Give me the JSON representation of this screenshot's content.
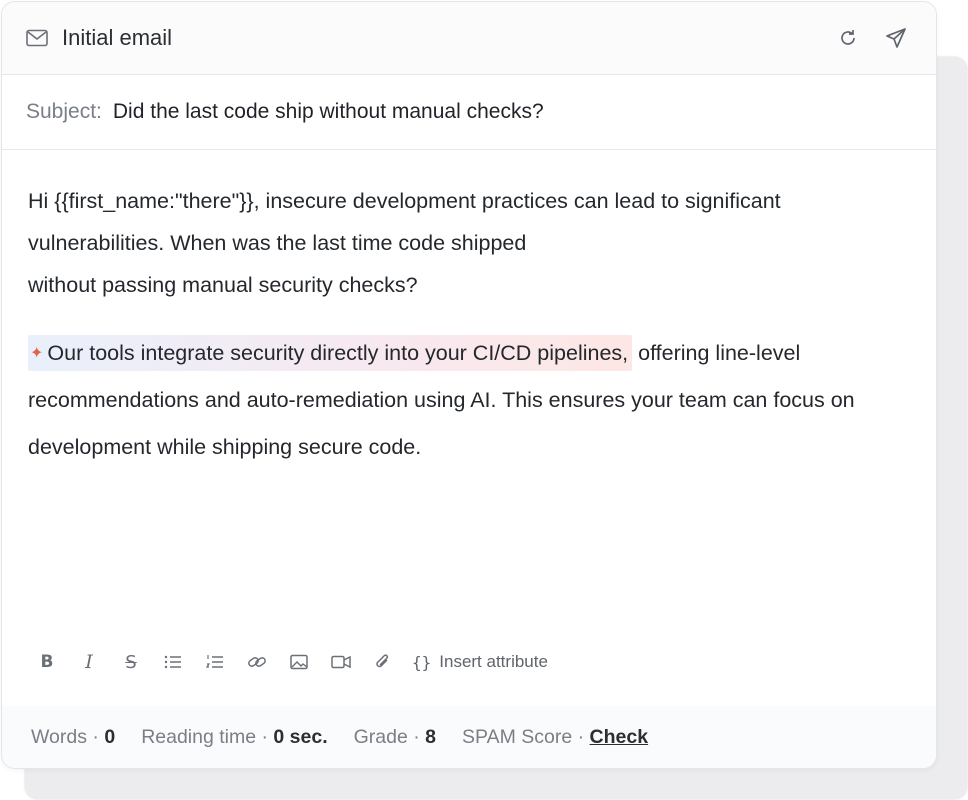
{
  "header": {
    "title": "Initial email"
  },
  "subject": {
    "label": "Subject:",
    "value": "Did the last code ship without manual checks?"
  },
  "body": {
    "p1_line1": "Hi {{first_name:\"there\"}}, insecure development practices can lead to significant",
    "p1_line2": "vulnerabilities. When was the last time code shipped",
    "p1_line3": "without passing manual security checks?",
    "p2_highlight": "Our tools integrate security directly into your CI/CD pipelines,",
    "p2_rest": " offering line-level recommendations and auto-remediation using AI. This ensures your team can focus on development while shipping secure code."
  },
  "toolbar": {
    "insert_attribute": "Insert attribute"
  },
  "footer": {
    "words_label": "Words · ",
    "words_value": "0",
    "reading_label": "Reading time · ",
    "reading_value": "0 sec.",
    "grade_label": "Grade · ",
    "grade_value": "8",
    "spam_label": "SPAM Score · ",
    "spam_link": "Check"
  },
  "icons": {
    "mail": "mail-icon",
    "refresh": "refresh-icon",
    "send": "send-icon",
    "sparkle": "sparkle-icon",
    "bold": "bold-icon",
    "italic": "italic-icon",
    "strike": "strikethrough-icon",
    "bullets": "bullet-list-icon",
    "numbered": "numbered-list-icon",
    "link": "link-icon",
    "image": "image-icon",
    "video": "video-icon",
    "attach": "attachment-icon",
    "braces": "braces-icon"
  },
  "colors": {
    "sparkle": "#e8604c",
    "muted": "#7a7f86",
    "text": "#1f2328"
  }
}
